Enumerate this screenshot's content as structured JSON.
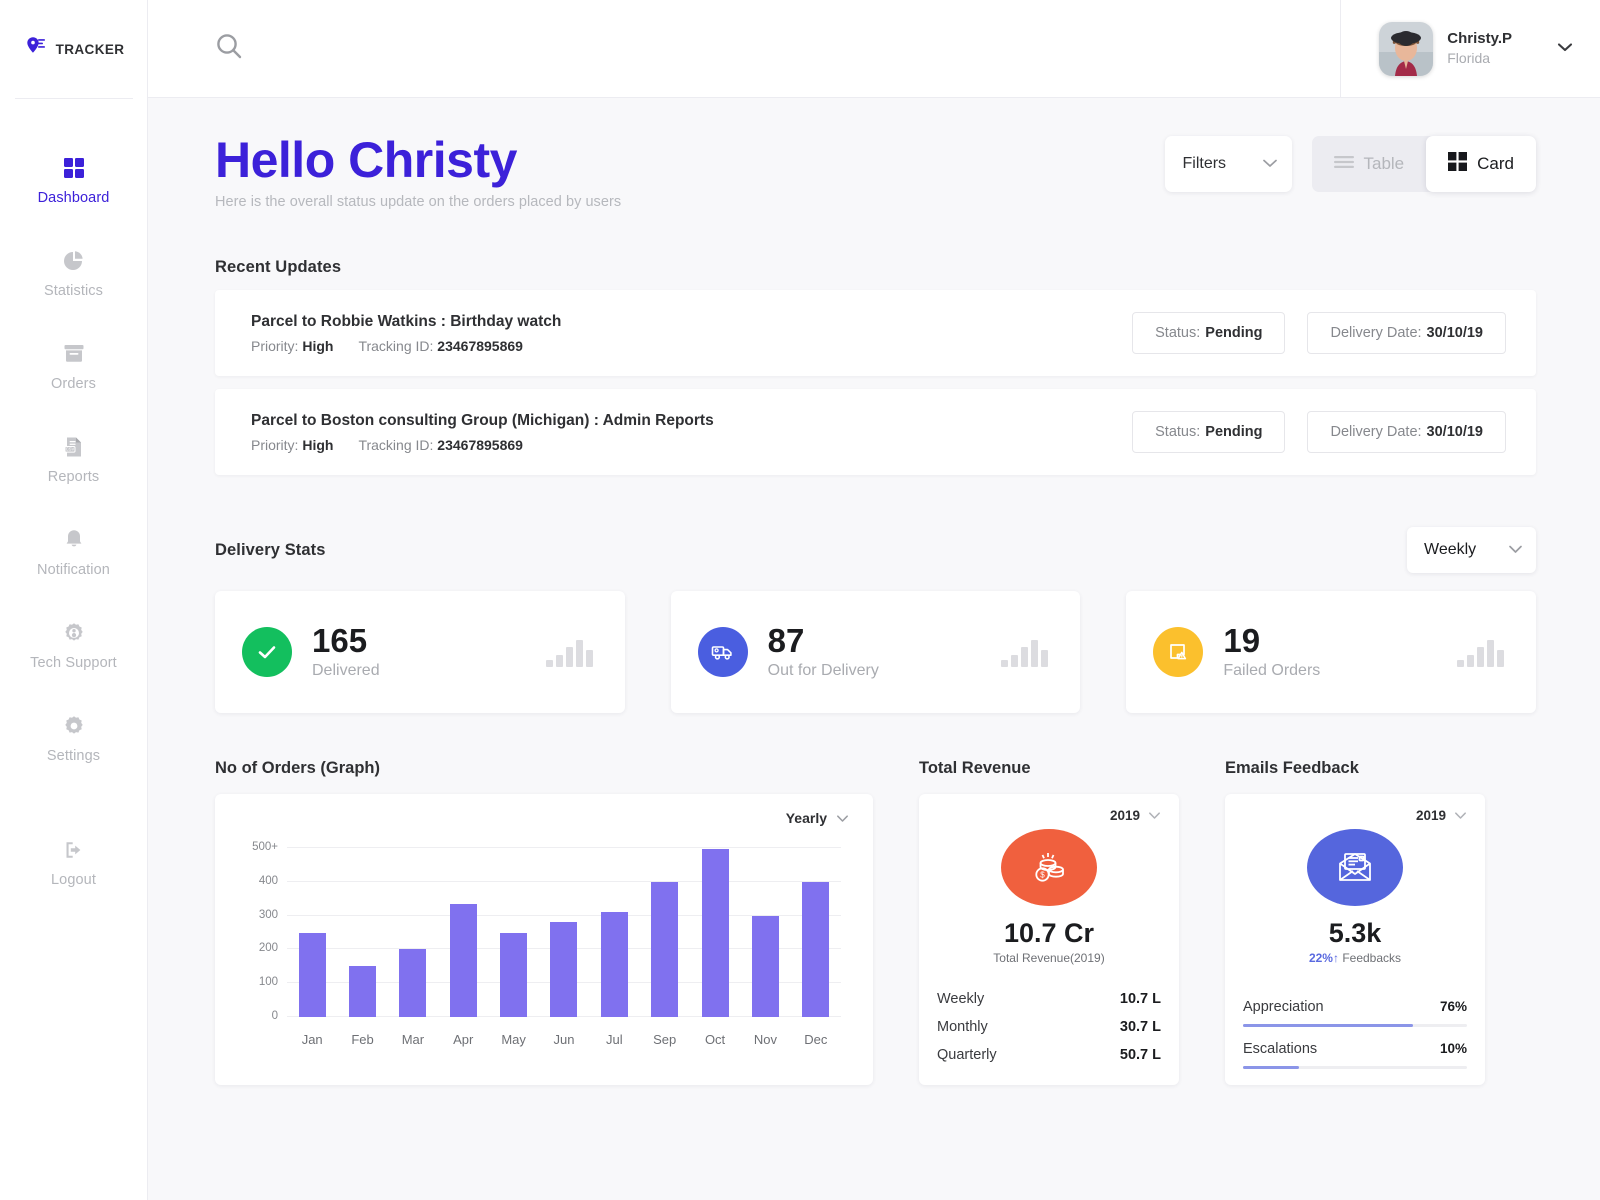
{
  "brand": {
    "name": "TRACKER",
    "icon": "location-pin-icon"
  },
  "sidebar": {
    "items": [
      {
        "label": "Dashboard",
        "icon": "grid-icon",
        "active": true
      },
      {
        "label": "Statistics",
        "icon": "pie-chart-icon",
        "active": false
      },
      {
        "label": "Orders",
        "icon": "box-icon",
        "active": false
      },
      {
        "label": "Reports",
        "icon": "csv-file-icon",
        "active": false
      },
      {
        "label": "Notification",
        "icon": "bell-icon",
        "active": false
      },
      {
        "label": "Tech Support",
        "icon": "support-gear-icon",
        "active": false
      },
      {
        "label": "Settings",
        "icon": "gear-icon",
        "active": false
      }
    ],
    "logout": {
      "label": "Logout",
      "icon": "logout-icon"
    }
  },
  "topbar": {
    "search_icon": "search-icon",
    "profile": {
      "name": "Christy.P",
      "location": "Florida",
      "chevron": "chevron-down-icon"
    }
  },
  "page": {
    "greeting": "Hello Christy",
    "subtitle": "Here is the overall status update on the orders placed by users",
    "filters_label": "Filters",
    "view_table_label": "Table",
    "view_card_label": "Card",
    "active_view": "Card"
  },
  "recent_updates": {
    "title": "Recent Updates",
    "items": [
      {
        "title": "Parcel to Robbie Watkins : Birthday watch",
        "priority_label": "Priority:",
        "priority_value": "High",
        "tracking_label": "Tracking ID:",
        "tracking_value": "23467895869",
        "status_label": "Status:",
        "status_value": "Pending",
        "date_label": "Delivery Date:",
        "date_value": "30/10/19"
      },
      {
        "title": "Parcel to Boston consulting Group (Michigan) : Admin Reports",
        "priority_label": "Priority:",
        "priority_value": "High",
        "tracking_label": "Tracking ID:",
        "tracking_value": "23467895869",
        "status_label": "Status:",
        "status_value": "Pending",
        "date_label": "Delivery Date:",
        "date_value": "30/10/19"
      }
    ]
  },
  "delivery_stats": {
    "title": "Delivery Stats",
    "period": "Weekly",
    "cards": [
      {
        "value": "165",
        "label": "Delivered",
        "icon": "check-circle-icon",
        "color": "#13bf5e"
      },
      {
        "value": "87",
        "label": "Out for Delivery",
        "icon": "delivery-truck-icon",
        "color": "#4a5ee0"
      },
      {
        "value": "19",
        "label": "Failed Orders",
        "icon": "failed-parcel-icon",
        "color": "#fbc02d"
      }
    ]
  },
  "orders_graph": {
    "title": "No of Orders (Graph)",
    "range": "Yearly"
  },
  "chart_data": {
    "type": "bar",
    "title": "No of Orders (Graph)",
    "categories": [
      "Jan",
      "Feb",
      "Mar",
      "Apr",
      "May",
      "Jun",
      "Jul",
      "Sep",
      "Oct",
      "Nov",
      "Dec"
    ],
    "values": [
      250,
      150,
      200,
      335,
      250,
      280,
      310,
      400,
      497,
      300,
      400
    ],
    "yticks": [
      "0",
      "100",
      "200",
      "300",
      "400",
      "500+"
    ],
    "ytick_values": [
      0,
      100,
      200,
      300,
      400,
      500
    ],
    "ylim": [
      0,
      500
    ],
    "xlabel": "",
    "ylabel": "",
    "grid": true,
    "series_color": "#8071ef",
    "legend": "none"
  },
  "total_revenue": {
    "title": "Total Revenue",
    "year": "2019",
    "icon": "coins-icon",
    "icon_color": "#f0603e",
    "value": "10.7 Cr",
    "caption": "Total Revenue(2019)",
    "rows": [
      {
        "label": "Weekly",
        "value": "10.7 L"
      },
      {
        "label": "Monthly",
        "value": "30.7 L"
      },
      {
        "label": "Quarterly",
        "value": "50.7 L"
      }
    ]
  },
  "emails_feedback": {
    "title": "Emails Feedback",
    "year": "2019",
    "icon": "open-envelope-icon",
    "icon_color": "#5566dd",
    "value": "5.3k",
    "delta": "22%",
    "delta_arrow": "↑",
    "caption": "Feedbacks",
    "bars": [
      {
        "label": "Appreciation",
        "pct_text": "76%",
        "pct": 76,
        "fill": 76
      },
      {
        "label": "Escalations",
        "pct_text": "10%",
        "pct": 10,
        "fill": 25
      }
    ]
  }
}
